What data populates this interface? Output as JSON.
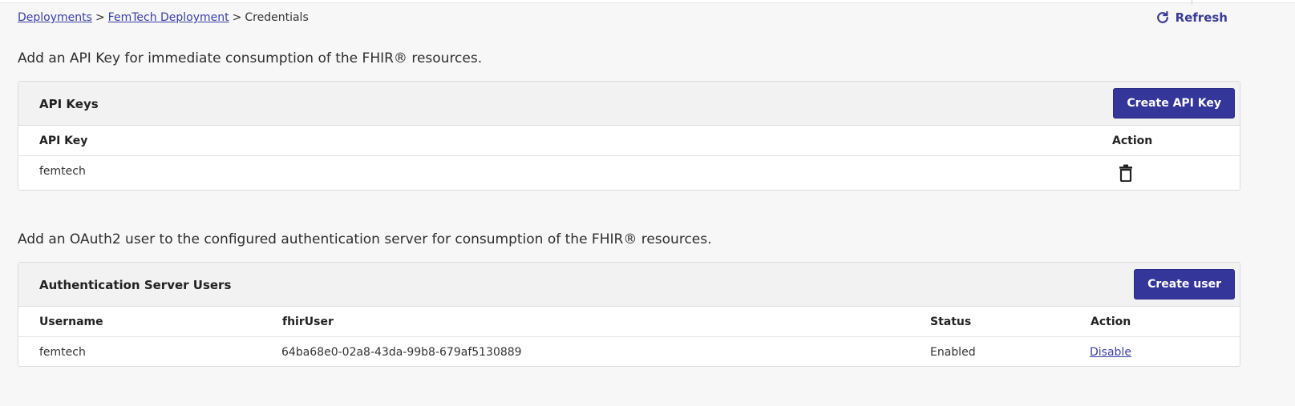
{
  "breadcrumb": {
    "items": [
      "Deployments",
      "FemTech Deployment"
    ],
    "current": "Credentials",
    "separator": ">"
  },
  "toolbar": {
    "refresh_label": "Refresh",
    "refresh_icon": "refresh-icon"
  },
  "api_keys": {
    "intro": "Add an API Key for immediate consumption of the FHIR® resources.",
    "title": "API Keys",
    "create_label": "Create API Key",
    "columns": [
      "API Key",
      "Action"
    ],
    "rows": [
      {
        "key": "femtech",
        "action_icon": "trash-icon"
      }
    ]
  },
  "auth_users": {
    "intro": "Add an OAuth2 user to the configured authentication server for consumption of the FHIR® resources.",
    "title": "Authentication Server Users",
    "create_label": "Create user",
    "columns": [
      "Username",
      "fhirUser",
      "Status",
      "Action"
    ],
    "rows": [
      {
        "username": "femtech",
        "fhir_user": "64ba68e0-02a8-43da-99b8-679af5130889",
        "status": "Enabled",
        "action": "Disable"
      }
    ]
  },
  "colors": {
    "primary": "#34369a",
    "link": "#3b3ea5",
    "background": "#f7f7f7",
    "header_bg": "#f2f2f2"
  }
}
